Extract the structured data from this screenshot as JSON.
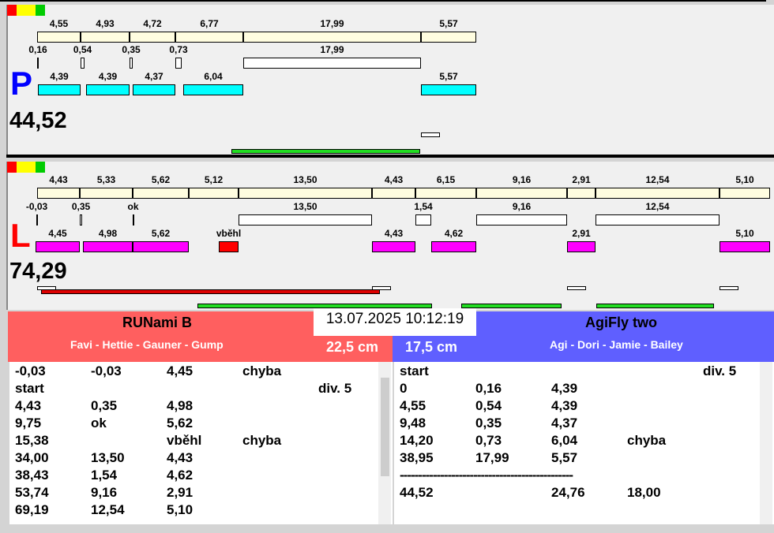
{
  "p_lane": {
    "letter": "P",
    "color": "#0000ff",
    "total": "44,52",
    "course": [
      "4,55",
      "4,93",
      "4,72",
      "6,77",
      "17,99",
      "5,57"
    ],
    "gaps": [
      "0,16",
      "0,54",
      "0,35",
      "0,73",
      "17,99"
    ],
    "runs": [
      "4,39",
      "4,39",
      "4,37",
      "6,04",
      "5,57"
    ]
  },
  "l_lane": {
    "letter": "L",
    "color": "#ff0000",
    "total": "74,29",
    "course": [
      "4,43",
      "5,33",
      "5,62",
      "5,12",
      "13,50",
      "4,43",
      "6,15",
      "9,16",
      "2,91",
      "12,54",
      "5,10"
    ],
    "gaps": [
      "-0,03",
      "0,35",
      "ok",
      "13,50",
      "1,54",
      "9,16",
      "12,54"
    ],
    "runs": [
      "4,45",
      "4,98",
      "5,62",
      "vběhl",
      "4,43",
      "4,62",
      "2,91",
      "5,10"
    ]
  },
  "datetime": "13.07.2025 10:12:19",
  "left_team": {
    "name": "RUNami B",
    "members": "Favi - Hettie - Gauner - Gump",
    "height": "22,5 cm",
    "color": "#ff5f5f",
    "rows": [
      [
        "-0,03",
        "-0,03",
        "4,45",
        "chyba",
        ""
      ],
      [
        "start",
        "",
        "",
        "",
        "div.  5"
      ],
      [
        "4,43",
        "0,35",
        "4,98",
        "",
        ""
      ],
      [
        "9,75",
        "ok",
        "5,62",
        "",
        ""
      ],
      [
        "15,38",
        "",
        "vběhl",
        "chyba",
        ""
      ],
      [
        "34,00",
        "13,50",
        "4,43",
        "",
        ""
      ],
      [
        "38,43",
        "1,54",
        "4,62",
        "",
        ""
      ],
      [
        "53,74",
        "9,16",
        "2,91",
        "",
        ""
      ],
      [
        "69,19",
        "12,54",
        "5,10",
        "",
        ""
      ]
    ]
  },
  "right_team": {
    "name": "AgiFly two",
    "members": "Agi - Dori - Jamie - Bailey",
    "height": "17,5 cm",
    "color": "#5f5fff",
    "rows": [
      [
        "start",
        "",
        "",
        "",
        "div.  5"
      ],
      [
        "0",
        "0,16",
        "4,39",
        "",
        ""
      ],
      [
        "4,55",
        "0,54",
        "4,39",
        "",
        ""
      ],
      [
        "9,48",
        "0,35",
        "4,37",
        "",
        ""
      ],
      [
        "14,20",
        "0,73",
        "6,04",
        "chyba",
        ""
      ],
      [
        "38,95",
        "17,99",
        "5,57",
        "",
        ""
      ],
      [
        "-----------------------------------------------",
        "",
        "",
        "",
        ""
      ],
      [
        "44,52",
        "",
        "24,76",
        "18,00",
        ""
      ]
    ]
  }
}
